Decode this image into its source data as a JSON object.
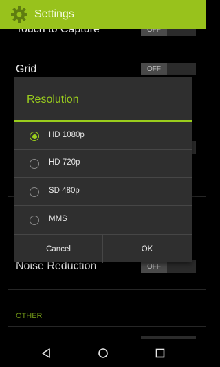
{
  "app_bar": {
    "title": "Settings",
    "icon": "gear-icon",
    "color": "#98c21c"
  },
  "settings": {
    "touch_to_capture": {
      "label": "Touch to Capture",
      "state": "OFF"
    },
    "grid": {
      "label": "Grid",
      "state": "OFF"
    },
    "noise_reduction": {
      "label": "Noise Reduction",
      "state": "OFF"
    },
    "section_other": "OTHER"
  },
  "dialog": {
    "title": "Resolution",
    "accent": "#9acd1d",
    "options": [
      {
        "label": "HD 1080p",
        "selected": true
      },
      {
        "label": "HD 720p",
        "selected": false
      },
      {
        "label": "SD 480p",
        "selected": false
      },
      {
        "label": "MMS",
        "selected": false
      }
    ],
    "cancel_label": "Cancel",
    "ok_label": "OK"
  },
  "navbar": {
    "back_icon": "back-icon",
    "home_icon": "home-icon",
    "recents_icon": "recents-icon"
  }
}
